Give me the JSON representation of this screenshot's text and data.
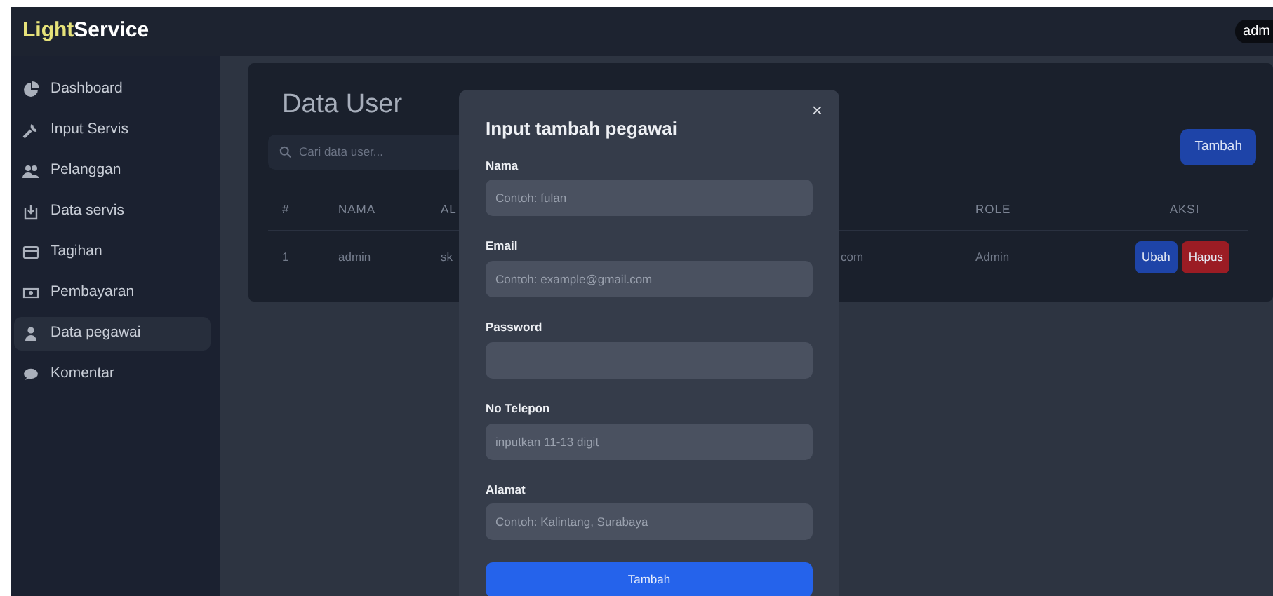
{
  "navbar": {
    "brand_highlight": "Light",
    "brand_rest": "Service",
    "user": "adm"
  },
  "sidebar": {
    "items": [
      {
        "label": "Dashboard",
        "selected": false
      },
      {
        "label": "Input Servis",
        "selected": false
      },
      {
        "label": "Pelanggan",
        "selected": false
      },
      {
        "label": "Data servis",
        "selected": false
      },
      {
        "label": "Tagihan",
        "selected": false
      },
      {
        "label": "Pembayaran",
        "selected": false
      },
      {
        "label": "Data pegawai",
        "selected": true
      },
      {
        "label": "Komentar",
        "selected": false
      }
    ]
  },
  "page": {
    "title": "Data User",
    "search": {
      "placeholder": "Cari data user..."
    },
    "add_button": "Tambah",
    "table": {
      "columns": [
        "#",
        "NAMA",
        "AL",
        "",
        "ROLE",
        "AKSI"
      ],
      "rows": [
        {
          "cells": [
            "1",
            "admin",
            "sk",
            "com",
            "Admin"
          ],
          "actions": [
            {
              "label": "Ubah",
              "kind": "edit"
            },
            {
              "label": "Hapus",
              "kind": "delete"
            }
          ]
        }
      ]
    }
  },
  "modal": {
    "title": "Input tambah pegawai",
    "close": "×",
    "fields": [
      {
        "label": "Nama",
        "placeholder": "Contoh: fulan"
      },
      {
        "label": "Email",
        "placeholder": "Contoh: example@gmail.com"
      },
      {
        "label": "Password"
      },
      {
        "label": "No Telepon",
        "placeholder": "inputkan 11-13 digit"
      },
      {
        "label": "Alamat",
        "placeholder": "Contoh: Kalintang, Surabaya"
      }
    ],
    "submit": "Tambah"
  }
}
